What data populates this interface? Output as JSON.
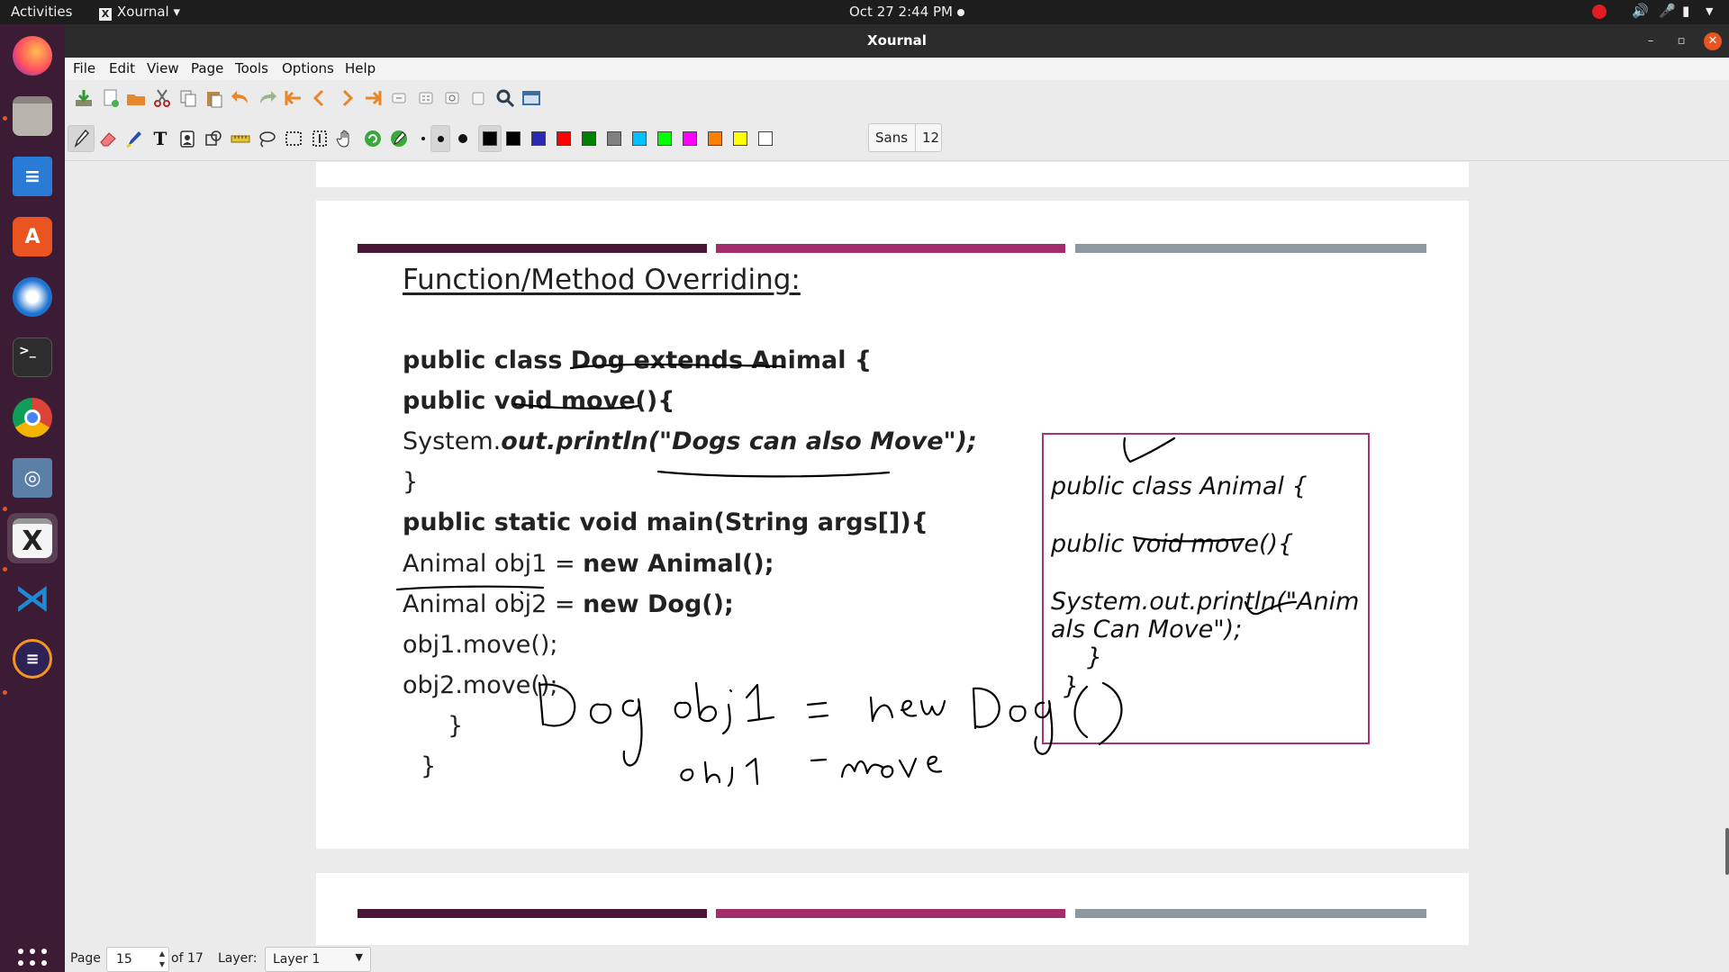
{
  "topbar": {
    "activities": "Activities",
    "app_name": "Xournal ▾",
    "clock": "Oct 27  2:44 PM"
  },
  "dock": {
    "items": [
      "Firefox",
      "Files",
      "LibreOffice Writer",
      "Ubuntu Software",
      "Thunderbird",
      "Terminal",
      "Chrome",
      "Screenshot",
      "Xournal",
      "VS Code",
      "Eclipse"
    ]
  },
  "window": {
    "title": "Xournal"
  },
  "menu": {
    "file": "File",
    "edit": "Edit",
    "view": "View",
    "page": "Page",
    "tools": "Tools",
    "options": "Options",
    "help": "Help"
  },
  "colors": {
    "palette": [
      "#000000",
      "#2a2ab4",
      "#ff0000",
      "#008000",
      "#808080",
      "#00c0ff",
      "#00ff00",
      "#ff00ff",
      "#ff8000",
      "#ffff00",
      "#ffffff"
    ],
    "current": "#000000",
    "ink": "#000000",
    "accent_box": "#a83277",
    "bar1": "#4a1636",
    "bar2": "#a12d6b",
    "bar3": "#8e98a1"
  },
  "font": {
    "name": "Sans",
    "size": "12"
  },
  "document": {
    "title": "Function/Method Overriding:",
    "code_lines": [
      "public class Dog extends Animal {",
      "public void move(){",
      "System.",
      "out.println(\"Dogs can also Move\");",
      "}",
      "public static void main(String args[]){",
      "Animal obj1",
      " = ",
      "new Animal();",
      "Animal obj2 = ",
      "new Dog();",
      "obj1.move();",
      "obj2.move();",
      "}",
      "}"
    ],
    "note_lines": [
      "public class Animal {",
      "public  void move(){",
      "System.out.println(\"Anim",
      "als Can Move\");",
      "}",
      "}"
    ]
  },
  "status": {
    "page_label": "Page",
    "page_value": "15",
    "of_total": "of 17",
    "layer_label": "Layer:",
    "layer_value": "Layer 1"
  }
}
